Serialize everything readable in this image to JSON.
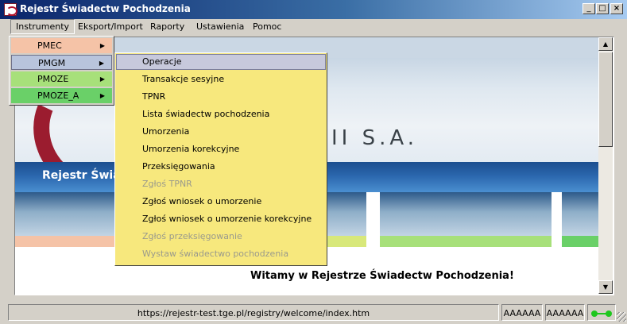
{
  "window": {
    "title": "Rejestr Świadectw Pochodzenia",
    "minimize": "_",
    "maximize": "□",
    "close": "×"
  },
  "menubar": [
    "Instrumenty",
    "Eksport/Import",
    "Raporty",
    "Ustawienia",
    "Pomoc"
  ],
  "instruments_menu": [
    {
      "label": "PMEC",
      "color": "#f5c3a7"
    },
    {
      "label": "PMGM",
      "color": "#b8c4dc"
    },
    {
      "label": "PMOZE",
      "color": "#a7e07a"
    },
    {
      "label": "PMOZE_A",
      "color": "#6ad068"
    }
  ],
  "pmgm_submenu": [
    {
      "label": "Operacje",
      "state": "selected"
    },
    {
      "label": "Transakcje sesyjne",
      "state": "enabled"
    },
    {
      "label": "TPNR",
      "state": "enabled"
    },
    {
      "label": "Lista świadectw pochodzenia",
      "state": "enabled"
    },
    {
      "label": "Umorzenia",
      "state": "enabled"
    },
    {
      "label": "Umorzenia korekcyjne",
      "state": "enabled"
    },
    {
      "label": "Przeksięgowania",
      "state": "enabled"
    },
    {
      "label": "Zgłoś TPNR",
      "state": "disabled"
    },
    {
      "label": "Zgłoś wniosek o umorzenie",
      "state": "enabled"
    },
    {
      "label": "Zgłoś wniosek o umorzenie korekcyjne",
      "state": "enabled"
    },
    {
      "label": "Zgłoś przeksięgowanie",
      "state": "disabled"
    },
    {
      "label": "Wystaw świadectwo pochodzenia",
      "state": "disabled"
    }
  ],
  "content": {
    "company_partial": "II S.A.",
    "banner_title_partial": "Rejestr Świa",
    "welcome": "Witamy w Rejestrze Świadectw Pochodzenia!",
    "strip_colors": [
      "#f5c3a7",
      "#d8e87a",
      "#a7e07a",
      "#6ad068"
    ]
  },
  "statusbar": {
    "url": "https://rejestr-test.tge.pl/registry/welcome/index.htm",
    "field1": "AAAAAA",
    "field2": "AAAAAA"
  }
}
